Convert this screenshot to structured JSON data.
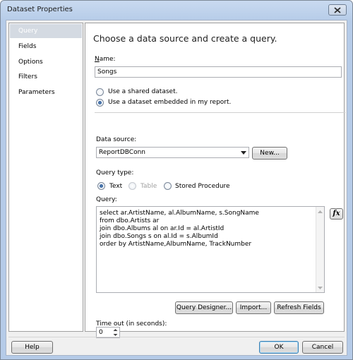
{
  "window": {
    "title": "Dataset Properties"
  },
  "nav": {
    "items": [
      {
        "label": "Query",
        "selected": true
      },
      {
        "label": "Fields"
      },
      {
        "label": "Options"
      },
      {
        "label": "Filters"
      },
      {
        "label": "Parameters"
      }
    ]
  },
  "panel": {
    "heading": "Choose a data source and create a query.",
    "name_label_u": "N",
    "name_label_rest": "ame:",
    "name_value": "Songs",
    "shared_dataset_label": "Use a shared dataset.",
    "embedded_dataset_label": "Use a dataset embedded in my report.",
    "data_source_label": "Data source:",
    "data_source_value": "ReportDBConn",
    "new_button": "New...",
    "query_type_label": "Query type:",
    "query_type_text": "Text",
    "query_type_table": "Table",
    "query_type_sp": "Stored Procedure",
    "query_label": "Query:",
    "query_lines": [
      "select ar.ArtistName, al.AlbumName, s.SongName",
      "from dbo.Artists ar",
      "join dbo.Albums al on ar.Id = al.ArtistId",
      "join dbo.Songs s on al.Id = s.AlbumId",
      "order by ArtistName,AlbumName, TrackNumber"
    ],
    "fx_label": "fx",
    "query_designer_button": "Query Designer...",
    "import_button": "Import...",
    "refresh_fields_button": "Refresh Fields",
    "timeout_label": "Time out (in seconds):",
    "timeout_value": "0"
  },
  "footer": {
    "help_button": "Help",
    "ok_button": "OK",
    "cancel_button": "Cancel"
  }
}
